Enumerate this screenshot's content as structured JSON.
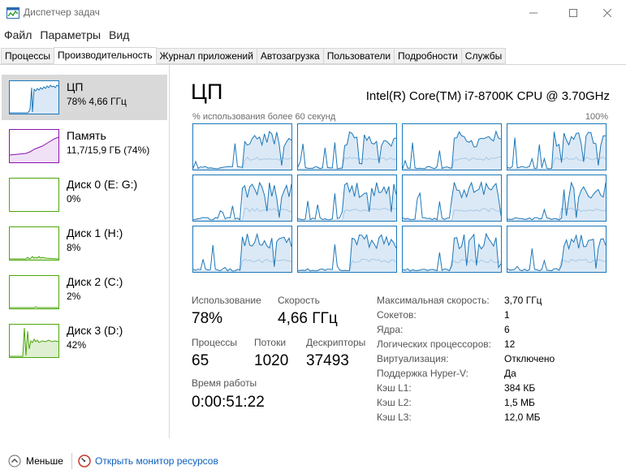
{
  "window": {
    "title": "Диспетчер задач"
  },
  "menu": [
    "Файл",
    "Параметры",
    "Вид"
  ],
  "tabs": [
    "Процессы",
    "Производительность",
    "Журнал приложений",
    "Автозагрузка",
    "Пользователи",
    "Подробности",
    "Службы"
  ],
  "active_tab": "Производительность",
  "colors": {
    "cpu": "#1c77b8",
    "memory": "#8b12ae",
    "disk": "#4da60c",
    "selected_bg": "#d9d9d9",
    "link": "#0e5fbb"
  },
  "sidebar": {
    "items": [
      {
        "name": "ЦП",
        "sub": "78% 4,66 ГГц",
        "kind": "cpu"
      },
      {
        "name": "Память",
        "sub": "11,7/15,9 ГБ (74%)",
        "kind": "memory"
      },
      {
        "name": "Диск 0 (E: G:)",
        "sub": "0%",
        "kind": "disk"
      },
      {
        "name": "Диск 1 (H:)",
        "sub": "8%",
        "kind": "disk"
      },
      {
        "name": "Диск 2 (C:)",
        "sub": "2%",
        "kind": "disk"
      },
      {
        "name": "Диск 3 (D:)",
        "sub": "42%",
        "kind": "disk"
      }
    ]
  },
  "main": {
    "title": "ЦП",
    "model": "Intel(R) Core(TM) i7-8700K CPU @ 3.70GHz",
    "graph_label": "% использования более 60 секунд",
    "graph_max": "100%",
    "stats": {
      "usage_label": "Использование",
      "usage_value": "78%",
      "speed_label": "Скорость",
      "speed_value": "4,66 ГГц",
      "processes_label": "Процессы",
      "processes_value": "65",
      "threads_label": "Потоки",
      "threads_value": "1020",
      "handles_label": "Дескрипторы",
      "handles_value": "37493",
      "uptime_label": "Время работы",
      "uptime_value": "0:00:51:22"
    },
    "specs": [
      {
        "label": "Максимальная скорость:",
        "value": "3,70 ГГц"
      },
      {
        "label": "Сокетов:",
        "value": "1"
      },
      {
        "label": "Ядра:",
        "value": "6"
      },
      {
        "label": "Логических процессоров:",
        "value": "12"
      },
      {
        "label": "Виртуализация:",
        "value": "Отключено"
      },
      {
        "label": "Поддержка Hyper-V:",
        "value": "Да"
      },
      {
        "label": "Кэш L1:",
        "value": "384 КБ"
      },
      {
        "label": "Кэш L2:",
        "value": "1,5 МБ"
      },
      {
        "label": "Кэш L3:",
        "value": "12,0 МБ"
      }
    ]
  },
  "footer": {
    "less_label": "Меньше",
    "monitor_label": "Открыть монитор ресурсов"
  }
}
